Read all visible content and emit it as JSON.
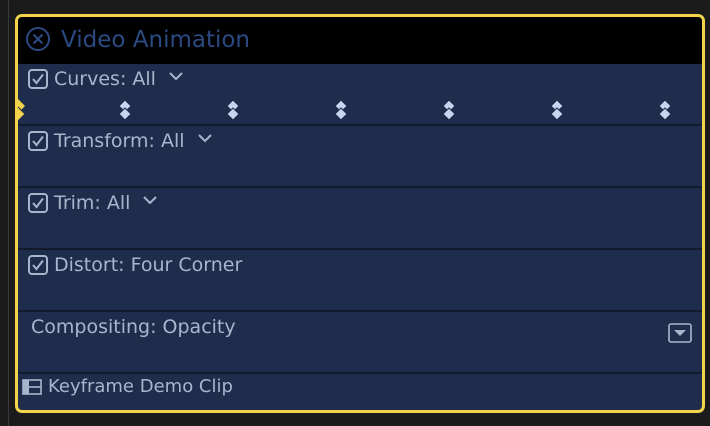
{
  "panel": {
    "title": "Video Animation"
  },
  "rows": [
    {
      "label": "Curves: All",
      "checked": true,
      "has_menu": true
    },
    {
      "label": "Transform: All",
      "checked": true,
      "has_menu": true
    },
    {
      "label": "Trim: All",
      "checked": true,
      "has_menu": true
    },
    {
      "label": "Distort: Four Corner",
      "checked": true,
      "has_menu": false
    },
    {
      "label": "Compositing: Opacity",
      "checked": false,
      "has_menu": false
    }
  ],
  "keyframes": {
    "count": 6,
    "edge_keyframe_color": "#f2d34b"
  },
  "clip": {
    "name": "Keyframe Demo Clip"
  },
  "colors": {
    "accent": "#f2d34b",
    "panel_bg": "#1e2d4c",
    "title_text": "#2c4a82",
    "row_text": "#a9b5cc"
  }
}
